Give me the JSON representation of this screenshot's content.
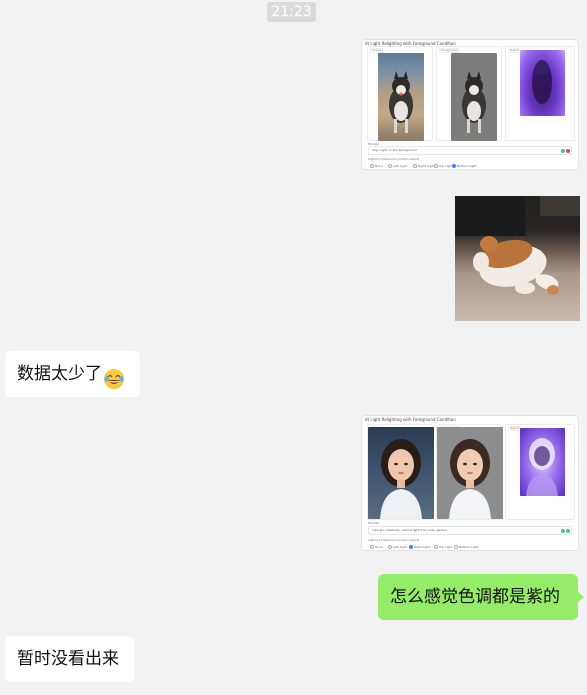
{
  "chat": {
    "timestamp": "21:23",
    "messages": [
      {
        "side": "right",
        "type": "image",
        "content": "relight-dog-screenshot"
      },
      {
        "side": "right",
        "type": "image",
        "content": "cat-photo"
      },
      {
        "side": "left",
        "type": "text",
        "text": "数据太少了",
        "emoji": "tears-of-joy-emoji"
      },
      {
        "side": "right",
        "type": "image",
        "content": "relight-portrait-screenshot"
      },
      {
        "side": "right",
        "type": "text",
        "text": "怎么感觉色调都是紫的"
      },
      {
        "side": "left",
        "type": "text",
        "text": "暂时没看出来"
      }
    ]
  },
  "shot1": {
    "heading": "d) Light Relighting with Foreground Condition",
    "panel_labels": [
      "Image",
      "Foreground",
      "Result"
    ],
    "prompt_title": "Prompt",
    "prompt_value": "dog, night, in the background",
    "pref_title": "Lighting Preference (Initial Latent)",
    "options": [
      "None",
      "Left Light",
      "Right Light",
      "Top Light",
      "Bottom Light"
    ],
    "selected_option": "Bottom Light"
  },
  "shot2": {
    "heading": "d) Light Relighting with Foreground Condition",
    "panel_labels": [
      "Image",
      "Foreground",
      "Result"
    ],
    "prompt_title": "Prompt",
    "prompt_value": "cute girl, shadows, natural light from side, garden,",
    "pref_title": "Lighting Preference (Initial Latent)",
    "options": [
      "None",
      "Left Light",
      "Right Light",
      "Top Light",
      "Bottom Light"
    ],
    "selected_option": "Right Light"
  },
  "colors": {
    "bubble_right": "#95ec69",
    "bubble_left": "#ffffff",
    "background": "#f2f2f2",
    "time_badge": "#dadada",
    "result_purple": "#8a4fe0"
  }
}
